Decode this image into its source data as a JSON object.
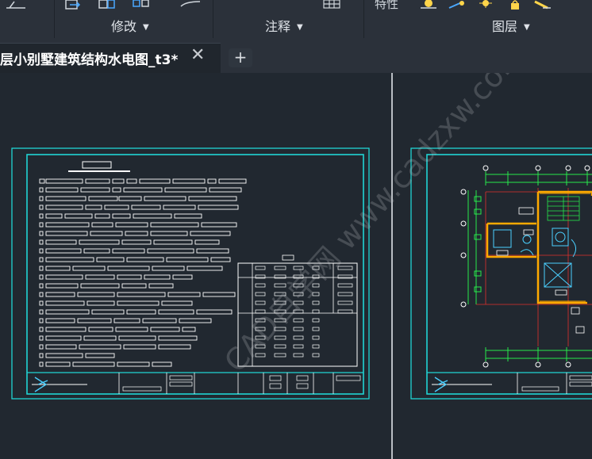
{
  "ribbon": {
    "panels": [
      {
        "label": "修改"
      },
      {
        "label": "注释"
      },
      {
        "label": "图层"
      }
    ],
    "properties_label": "特性"
  },
  "tabs": {
    "document_title": "层小别墅建筑结构水电图_t3*",
    "close_symbol": "✕",
    "add_symbol": "+"
  },
  "watermark": "CAD自学网 www.cadzxw.com",
  "colors": {
    "background": "#212830",
    "ribbon": "#2b313a",
    "frame_cyan": "#20d4d4",
    "drawing_white": "#ffffff",
    "wall_orange": "#ffaa00",
    "axis_red": "#e0302c",
    "dimension_green": "#27e84a"
  }
}
